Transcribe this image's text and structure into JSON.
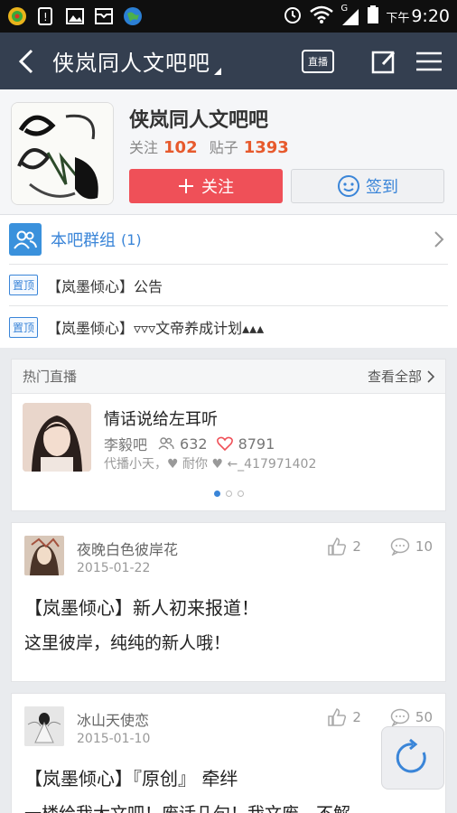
{
  "status_bar": {
    "ampm": "下午",
    "time": "9:20",
    "signal_label": "G"
  },
  "topbar": {
    "title": "侠岚同人文吧吧",
    "live_label": "直播"
  },
  "forum": {
    "name": "侠岚同人文吧吧",
    "follow_label": "关注",
    "follow_count": "102",
    "posts_label": "贴子",
    "posts_count": "1393",
    "follow_button": "关注",
    "sign_button": "签到"
  },
  "group": {
    "label": "本吧群组",
    "count": "(1)"
  },
  "pinned": [
    {
      "badge": "置顶",
      "title": "【岚墨倾心】公告"
    },
    {
      "badge": "置顶",
      "title": "【岚墨倾心】▿▿▿文帝养成计划▴▴▴"
    }
  ],
  "live": {
    "header": "热门直播",
    "more": "查看全部",
    "title": "情话说给左耳听",
    "host": "李毅吧",
    "viewers": "632",
    "likes": "8791",
    "desc": "代播小天，♥ 耐你 ♥ ←_417971402"
  },
  "posts": [
    {
      "author": "夜晚白色彼岸花",
      "date": "2015-01-22",
      "likes": "2",
      "comments": "10",
      "title": "【岚墨倾心】新人初来报道！",
      "body": "这里彼岸，纯纯的新人哦！"
    },
    {
      "author": "冰山天使恋",
      "date": "2015-01-10",
      "likes": "2",
      "comments": "50",
      "title": "【岚墨倾心】『原创』 牵绊",
      "body": "一楼给我大文吧！废话几句！我文废，不解"
    }
  ],
  "colors": {
    "topbar": "#343f50",
    "accent_blue": "#3a85d8",
    "follow_red": "#ef5058",
    "count_orange": "#e75a2d"
  }
}
